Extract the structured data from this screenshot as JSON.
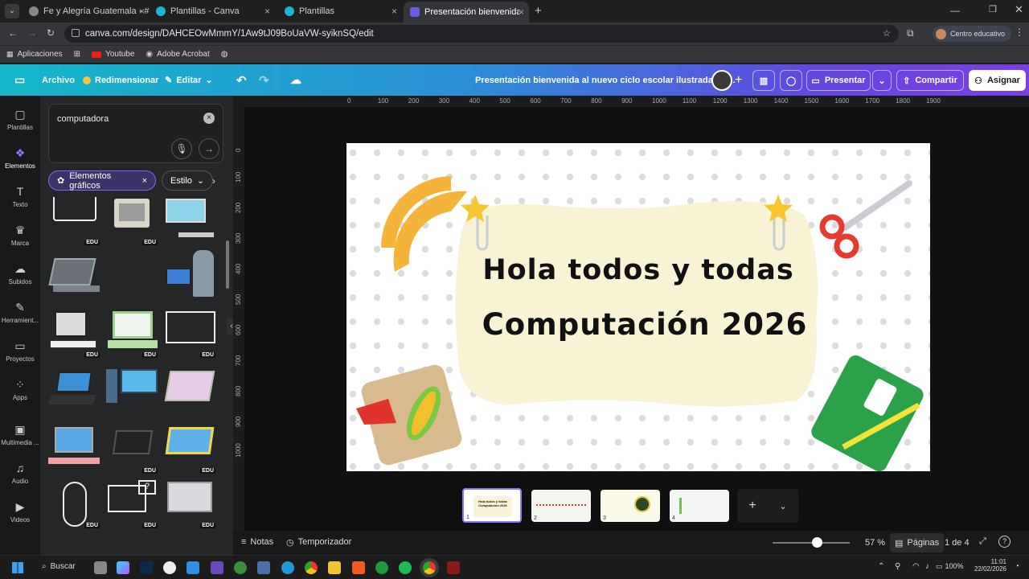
{
  "browser": {
    "tabs": [
      {
        "title": "Fe y Alegría Guatemala - #Som",
        "active": false
      },
      {
        "title": "Plantillas - Canva",
        "active": false
      },
      {
        "title": "Plantillas",
        "active": false
      },
      {
        "title": "Presentación bienvenida al nue",
        "active": true
      }
    ],
    "url": "canva.com/design/DAHCEOwMmmY/1Aw9tJ09BoUaVW-syiknSQ/edit",
    "profile_label": "Centro educativo",
    "bookmarks": [
      "Aplicaciones",
      "Youtube",
      "Adobe Acrobat"
    ]
  },
  "header": {
    "file_label": "Archivo",
    "resize_label": "Redimensionar",
    "edit_label": "Editar",
    "doc_title": "Presentación bienvenida al nuevo ciclo escolar ilustrada y c...",
    "present_label": "Presentar",
    "share_label": "Compartir",
    "assign_label": "Asignar"
  },
  "rail": [
    {
      "label": "Plantillas",
      "icon": "templates-icon"
    },
    {
      "label": "Elementos",
      "icon": "elements-icon"
    },
    {
      "label": "Texto",
      "icon": "text-icon"
    },
    {
      "label": "Marca",
      "icon": "brand-icon"
    },
    {
      "label": "Subidos",
      "icon": "uploads-icon"
    },
    {
      "label": "Herramient...",
      "icon": "tools-icon"
    },
    {
      "label": "Proyectos",
      "icon": "folder-icon"
    },
    {
      "label": "Apps",
      "icon": "apps-icon"
    },
    {
      "label": "Multimedia ...",
      "icon": "media-icon"
    },
    {
      "label": "Audio",
      "icon": "audio-icon"
    },
    {
      "label": "Videos",
      "icon": "video-icon"
    }
  ],
  "panel": {
    "search_value": "computadora",
    "chip_graphics": "Elementos gráficos",
    "chip_style": "Estilo",
    "edu_badge": "EDU"
  },
  "ruler": {
    "h_ticks": [
      "0",
      "100",
      "200",
      "300",
      "400",
      "500",
      "600",
      "700",
      "800",
      "900",
      "1000",
      "1100",
      "1200",
      "1300",
      "1400",
      "1500",
      "1600",
      "1700",
      "1800",
      "1900"
    ],
    "v_ticks": [
      "0",
      "100",
      "200",
      "300",
      "400",
      "500",
      "600",
      "700",
      "800",
      "900",
      "1000"
    ]
  },
  "slide": {
    "line1": "Hola todos y todas",
    "line2": "Computación 2026"
  },
  "thumbnails": [
    {
      "num": "1",
      "text": "Hola todos y todas Computación 2026"
    },
    {
      "num": "2",
      "text": ""
    },
    {
      "num": "3",
      "text": ""
    },
    {
      "num": "4",
      "text": ""
    }
  ],
  "bottom": {
    "notes_label": "Notas",
    "timer_label": "Temporizador",
    "zoom": "57 %",
    "zoom_fraction": 0.57,
    "pages_label": "Páginas",
    "page_count": "1 de 4"
  },
  "taskbar": {
    "search_label": "Buscar",
    "battery": "100%",
    "time": "11:01",
    "date": "22/02/2026"
  },
  "colors": {
    "header_start": "#13b8c9",
    "header_end": "#7b3fe4",
    "slide_note_bg": "#f7f3d4",
    "accent_purple": "#7b3fe4"
  }
}
